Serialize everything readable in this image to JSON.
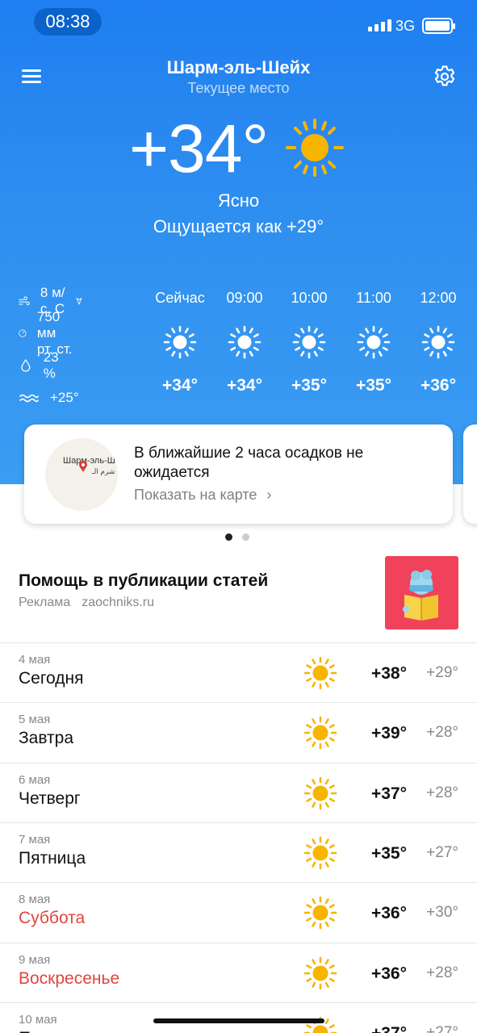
{
  "status_bar": {
    "time": "08:38",
    "network": "3G"
  },
  "header": {
    "city": "Шарм-эль-Шейх",
    "location_label": "Текущее место"
  },
  "current": {
    "temperature": "+34°",
    "condition": "Ясно",
    "feels_like": "Ощущается как +29°",
    "icon": "sun-icon"
  },
  "details": {
    "wind": "8 м/с, С",
    "pressure": "750 мм рт. ст.",
    "humidity": "23 %",
    "water_temp": "+25°"
  },
  "hourly": [
    {
      "label": "Сейчас",
      "temp": "+34°",
      "icon": "sun-icon"
    },
    {
      "label": "09:00",
      "temp": "+34°",
      "icon": "sun-icon"
    },
    {
      "label": "10:00",
      "temp": "+35°",
      "icon": "sun-icon"
    },
    {
      "label": "11:00",
      "temp": "+35°",
      "icon": "sun-icon"
    },
    {
      "label": "12:00",
      "temp": "+36°",
      "icon": "sun-icon"
    }
  ],
  "precip_card": {
    "text": "В ближайшие 2 часа осадков не ожидается",
    "link": "Показать на карте",
    "map_label": "Шарм-эль-Шейх",
    "map_label_arabic": "شرم الـ"
  },
  "ad": {
    "title": "Помощь в публикации статей",
    "label": "Реклама",
    "domain": "zaochniks.ru"
  },
  "days": [
    {
      "date": "4 мая",
      "name": "Сегодня",
      "hi": "+38°",
      "lo": "+29°",
      "weekend": false
    },
    {
      "date": "5 мая",
      "name": "Завтра",
      "hi": "+39°",
      "lo": "+28°",
      "weekend": false
    },
    {
      "date": "6 мая",
      "name": "Четверг",
      "hi": "+37°",
      "lo": "+28°",
      "weekend": false
    },
    {
      "date": "7 мая",
      "name": "Пятница",
      "hi": "+35°",
      "lo": "+27°",
      "weekend": false
    },
    {
      "date": "8 мая",
      "name": "Суббота",
      "hi": "+36°",
      "lo": "+30°",
      "weekend": true
    },
    {
      "date": "9 мая",
      "name": "Воскресенье",
      "hi": "+36°",
      "lo": "+28°",
      "weekend": true
    },
    {
      "date": "10 мая",
      "name": "П",
      "hi": "+37°",
      "lo": "+27°",
      "weekend": false
    }
  ],
  "colors": {
    "accent_blue": "#2f8ff0",
    "sun": "#f7b500",
    "weekend": "#e0463d"
  }
}
